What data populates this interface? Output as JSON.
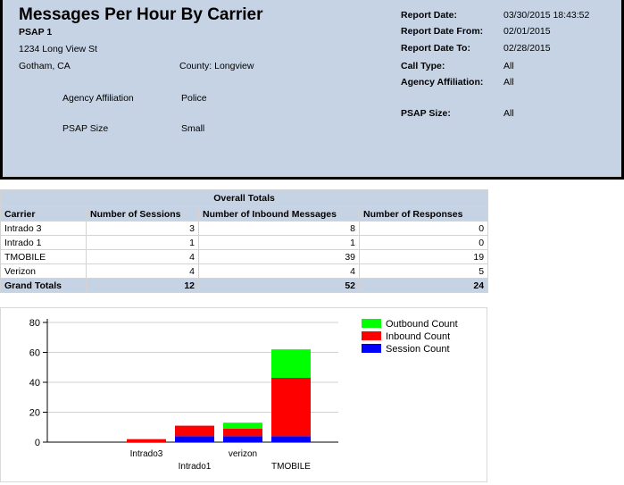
{
  "report": {
    "title": "Messages Per Hour By Carrier",
    "psap_name": "PSAP 1",
    "address_line1": "1234 Long View St",
    "city_state": "Gotham, CA",
    "county": "County: Longview",
    "agency_affiliation_label": "Agency Affiliation",
    "agency_affiliation_value": "Police",
    "psap_size_label": "PSAP Size",
    "psap_size_value": "Small"
  },
  "meta": {
    "report_date_label": "Report Date:",
    "report_date": "03/30/2015 18:43:52",
    "date_from_label": "Report Date From:",
    "date_from": "02/01/2015",
    "date_to_label": "Report Date To:",
    "date_to": "02/28/2015",
    "call_type_label": "Call Type:",
    "call_type": "All",
    "agency_label": "Agency Affiliation:",
    "agency": "All",
    "psap_size_label": "PSAP Size:",
    "psap_size": "All"
  },
  "totals": {
    "caption": "Overall Totals",
    "headers": [
      "Carrier",
      "Number of Sessions",
      "Number of Inbound Messages",
      "Number of Responses"
    ],
    "rows": [
      [
        "Intrado 3",
        "3",
        "8",
        "0"
      ],
      [
        "Intrado 1",
        "1",
        "1",
        "0"
      ],
      [
        "TMOBILE",
        "4",
        "39",
        "19"
      ],
      [
        "Verizon",
        "4",
        "4",
        "5"
      ]
    ],
    "grand": [
      "Grand Totals",
      "12",
      "52",
      "24"
    ]
  },
  "chart_data": {
    "type": "bar",
    "stacked": true,
    "categories": [
      "Intrado3",
      "Intrado1",
      "verizon",
      "TMOBILE"
    ],
    "series": [
      {
        "name": "Session Count",
        "color": "#0000ff",
        "values": [
          0,
          4,
          4,
          4
        ]
      },
      {
        "name": "Inbound Count",
        "color": "#ff0000",
        "values": [
          2,
          7,
          5,
          39
        ]
      },
      {
        "name": "Outbound Count",
        "color": "#00ff00",
        "values": [
          0,
          0,
          4,
          19
        ]
      }
    ],
    "legend_order": [
      "Outbound Count",
      "Inbound Count",
      "Session Count"
    ],
    "yticks": [
      0,
      20,
      40,
      60,
      80
    ],
    "ylim": [
      0,
      80
    ],
    "grid": true,
    "legend_position": "top-right"
  }
}
